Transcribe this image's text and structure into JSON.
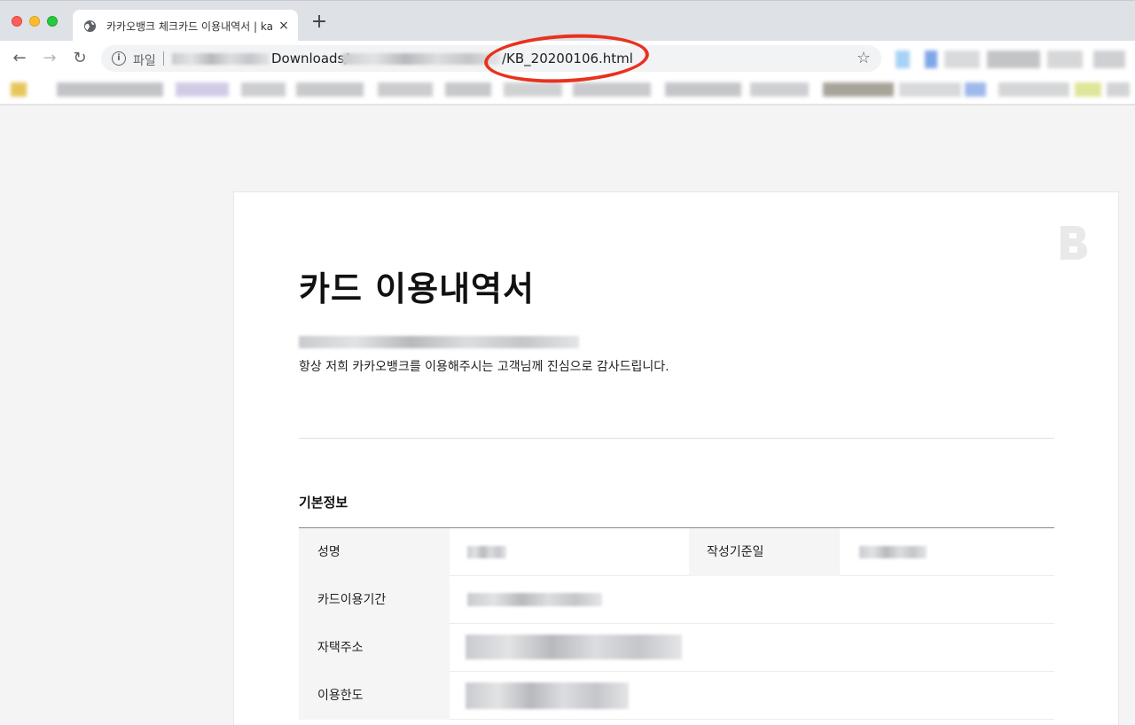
{
  "browser": {
    "tab": {
      "title": "카카오뱅크 체크카드 이용내역서 | ka",
      "close_glyph": "×",
      "icon": "globe-icon"
    },
    "new_tab_glyph": "+",
    "nav": {
      "back_glyph": "←",
      "forward_glyph": "→",
      "reload_glyph": "↻"
    },
    "address_bar": {
      "info_glyph": "i",
      "scheme_label": "파일",
      "url_visible_middle": "Downloads/",
      "url_visible_end": "/KB_20200106.html",
      "bookmark_glyph": "☆"
    },
    "annotation_color": "#e8321e"
  },
  "page": {
    "title": "카드 이용내역서",
    "greeting": "항상 저희 카카오뱅크를 이용해주시는 고객님께 진심으로 감사드립니다.",
    "section_title": "기본정보",
    "fields": {
      "name_label": "성명",
      "created_date_label": "작성기준일",
      "card_period_label": "카드이용기간",
      "address_label": "자택주소",
      "limit_label": "이용한도"
    }
  }
}
